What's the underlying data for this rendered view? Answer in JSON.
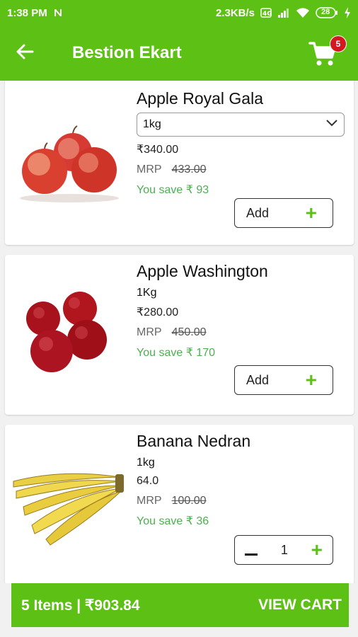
{
  "status_bar": {
    "time": "1:38 PM",
    "network_speed": "2.3KB/s",
    "battery": "28",
    "icons": [
      "notification-n-icon",
      "volte-icon",
      "signal-icon",
      "wifi-icon",
      "battery-icon",
      "charging-icon"
    ]
  },
  "app_bar": {
    "title": "Bestion Ekart",
    "cart_count": "5",
    "color": "#5dc015"
  },
  "products": [
    {
      "name": "Apple Royal Gala",
      "variant": "1kg",
      "variant_type": "dropdown",
      "price": "₹340.00",
      "mrp_label": "MRP",
      "mrp": "433.00",
      "save": "You save ₹ 93",
      "action_label": "Add"
    },
    {
      "name": "Apple Washington",
      "variant": "1Kg",
      "variant_type": "static",
      "price": "₹280.00",
      "mrp_label": "MRP",
      "mrp": "450.00",
      "save": "You save ₹ 170",
      "action_label": "Add"
    },
    {
      "name": "Banana Nedran",
      "variant": "1kg",
      "variant_type": "static",
      "price": "64.0",
      "mrp_label": "MRP",
      "mrp": "100.00",
      "save": "You save ₹ 36",
      "quantity": "1"
    }
  ],
  "bottom_bar": {
    "summary": "5 Items | ₹903.84",
    "action": "VIEW CART"
  },
  "colors": {
    "accent": "#5dc015",
    "save_text": "#4caf50",
    "badge": "#d31920"
  }
}
